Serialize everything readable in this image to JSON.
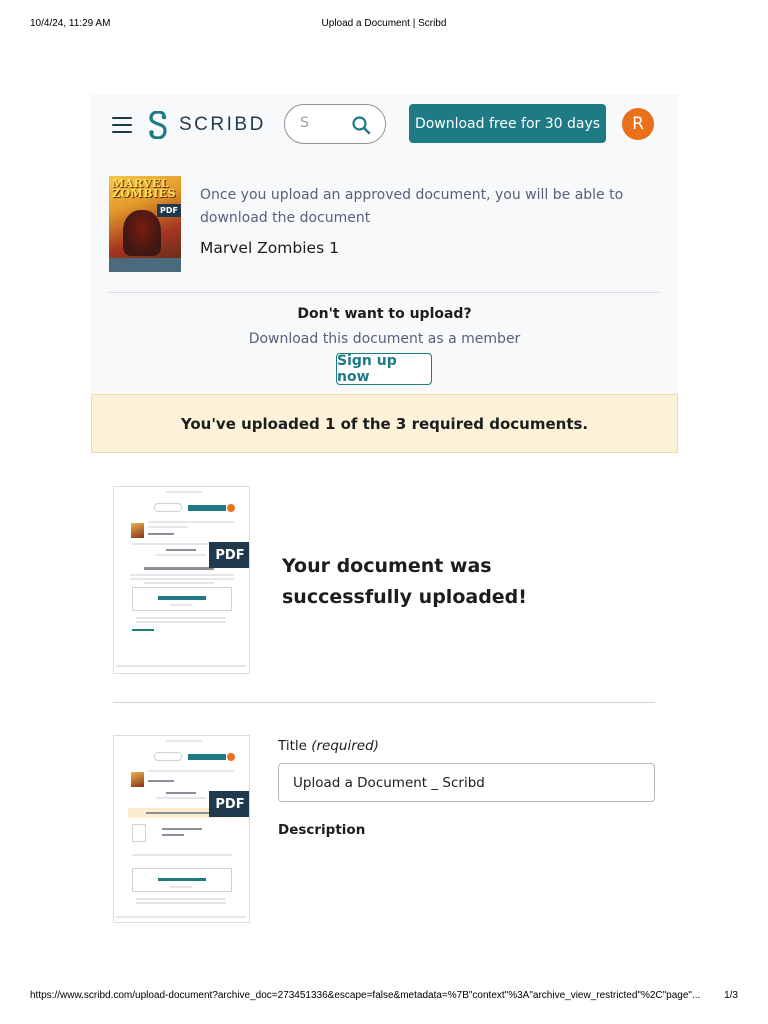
{
  "print": {
    "date": "10/4/24, 11:29 AM",
    "title": "Upload a Document | Scribd",
    "url": "https://www.scribd.com/upload-document?archive_doc=273451336&escape=false&metadata=%7B\"context\"%3A\"archive_view_restricted\"%2C\"page\"...",
    "page": "1/3"
  },
  "header": {
    "logo_text": "SCRIBD",
    "search_placeholder": "S",
    "download_button": "Download free for 30 days",
    "avatar_initial": "R"
  },
  "upload_info": {
    "cover_title": "MARVEL ZOMBIES",
    "pdf_tag": "PDF",
    "message": "Once you upload an approved document, you will be able to download the document",
    "document_title": "Marvel Zombies 1",
    "dont_want": "Don't want to upload?",
    "member_text": "Download this document as a member",
    "signup_button": "Sign up now"
  },
  "progress_banner": "You've uploaded 1 of the 3 required documents.",
  "uploaded": {
    "pdf_label": "PDF",
    "success_message": "Your document was successfully uploaded!"
  },
  "form": {
    "title_label": "Title",
    "title_required": "(required)",
    "title_value": "Upload a Document _ Scribd",
    "description_label": "Description"
  },
  "colors": {
    "brand_teal": "#1e7b85",
    "brand_navy": "#1e3a4c",
    "avatar_orange": "#e9711b",
    "banner_bg": "#fdf1d8"
  },
  "icons": [
    "menu-icon",
    "scribd-logo-icon",
    "search-icon",
    "pdf-icon"
  ]
}
